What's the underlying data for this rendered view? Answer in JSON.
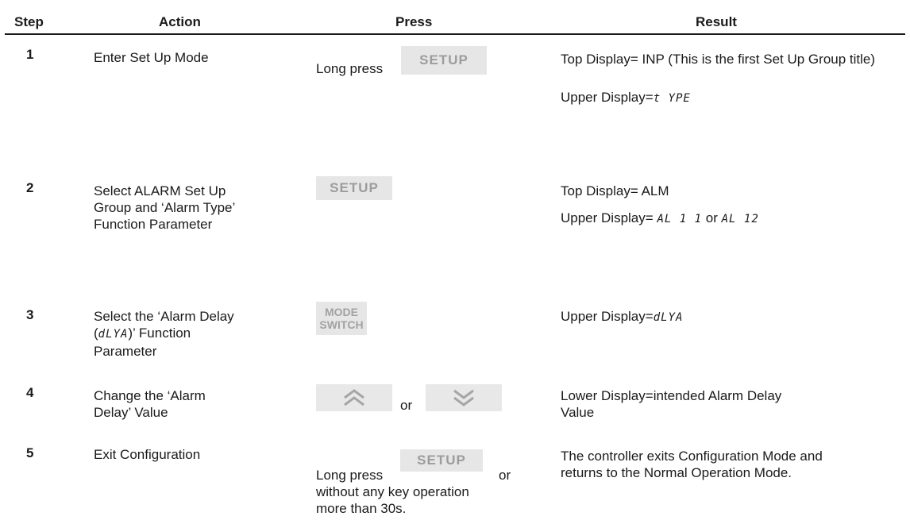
{
  "headers": {
    "step": "Step",
    "action": "Action",
    "press": "Press",
    "result": "Result"
  },
  "rows": [
    {
      "step": "1",
      "action": "Enter Set Up Mode",
      "press": {
        "prefix": "Long press",
        "key": "SETUP"
      },
      "result": {
        "line1": "Top Display= INP (This is the first Set Up Group title)",
        "line2_prefix": "Upper Display=",
        "line2_seg": "t YPE"
      }
    },
    {
      "step": "2",
      "action": "Select ALARM Set Up Group and ‘Alarm Type’ Function Parameter",
      "press": {
        "key": "SETUP"
      },
      "result": {
        "line1": "Top Display= ALM",
        "line2_prefix": "Upper Display=",
        "seg_a": "AL 1 1",
        "or": "or",
        "seg_b": "AL 12"
      }
    },
    {
      "step": "3",
      "action_pre": "Select the ‘Alarm Delay (",
      "action_seg": "dLYA",
      "action_post": ")’ Function Parameter",
      "press": {
        "key_line1": "MODE",
        "key_line2": "SWITCH"
      },
      "result": {
        "prefix": "Upper Display=",
        "seg": "dLYA"
      }
    },
    {
      "step": "4",
      "action": "Change the ‘Alarm Delay’ Value",
      "press": {
        "up_icon": "double-chevron-up-icon",
        "or": "or",
        "down_icon": "double-chevron-down-icon"
      },
      "result": {
        "text": "Lower Display=intended Alarm Delay Value"
      }
    },
    {
      "step": "5",
      "action": "Exit Configuration",
      "press": {
        "prefix": "Long press",
        "key": "SETUP",
        "suffix": "or",
        "rest": "without any key operation more than 30s."
      },
      "result": {
        "text": "The controller exits Configuration Mode and returns to the Normal Operation Mode."
      }
    }
  ]
}
